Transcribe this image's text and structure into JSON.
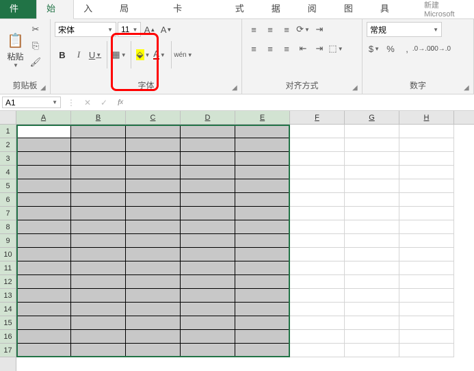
{
  "title_partial": "新建 Microsoft",
  "tabs": {
    "file": "文件",
    "home": "开始",
    "insert": "插入",
    "layout": "页面布局",
    "newtab": "新建选项卡",
    "formulas": "公式",
    "data": "数据",
    "review": "审阅",
    "view": "视图",
    "pdf": "PDF工具"
  },
  "ribbon": {
    "clipboard": {
      "paste": "粘贴",
      "label": "剪贴板"
    },
    "font": {
      "name": "宋体",
      "size": "11",
      "label": "字体",
      "wen": "wén"
    },
    "align": {
      "label": "对齐方式"
    },
    "number": {
      "format": "常规",
      "label": "数字"
    }
  },
  "namebox": "A1",
  "columns": [
    "A",
    "B",
    "C",
    "D",
    "E",
    "F",
    "G",
    "H"
  ],
  "sel_cols": 5,
  "rows": [
    1,
    2,
    3,
    4,
    5,
    6,
    7,
    8,
    9,
    10,
    11,
    12,
    13,
    14,
    15,
    16,
    17
  ],
  "sel_rows": 17
}
